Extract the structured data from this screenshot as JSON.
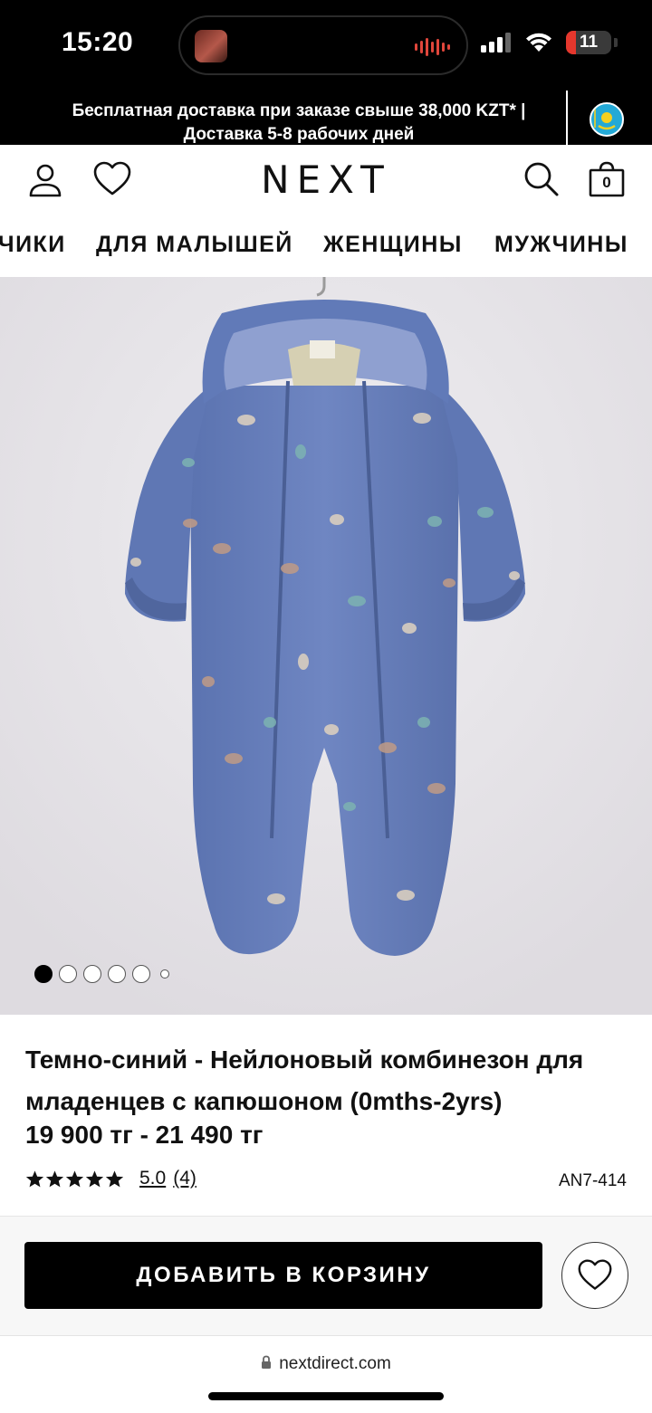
{
  "status_bar": {
    "time": "15:20",
    "battery": "11",
    "battery_level": 0.11
  },
  "promo": {
    "text": "Бесплатная доставка при заказе свыше 38,000 KZT* | Доставка 5-8 рабочих дней",
    "flag_icon": "kazakhstan-flag-icon"
  },
  "header": {
    "logo": "NEXT",
    "account_icon": "user-icon",
    "wishlist_icon": "heart-icon",
    "search_icon": "search-icon",
    "bag_icon": "shopping-bag-icon",
    "bag_count": "0"
  },
  "categories": {
    "items": [
      {
        "label": "ЧИКИ"
      },
      {
        "label": "ДЛЯ МАЛЫШЕЙ"
      },
      {
        "label": "ЖЕНЩИНЫ"
      },
      {
        "label": "МУЖЧИНЫ"
      }
    ]
  },
  "gallery": {
    "image_count": 6,
    "active_index": 0
  },
  "product": {
    "title": "Темно-синий - Нейлоновый комбинезон для младенцев с капюшоном (0mths-2yrs)",
    "price": "19 900 тг - 21 490 тг",
    "rating_value": "5.0",
    "rating_count": "(4)",
    "stars": 5,
    "sku": "AN7-414"
  },
  "actions": {
    "add_to_cart": "ДОБАВИТЬ В КОРЗИНУ",
    "wishlist_icon": "heart-icon"
  },
  "browser": {
    "url": "nextdirect.com",
    "lock_icon": "lock-icon"
  },
  "colors": {
    "garment": "#6a82bf",
    "background": "#e8e6ea",
    "black": "#000000"
  }
}
